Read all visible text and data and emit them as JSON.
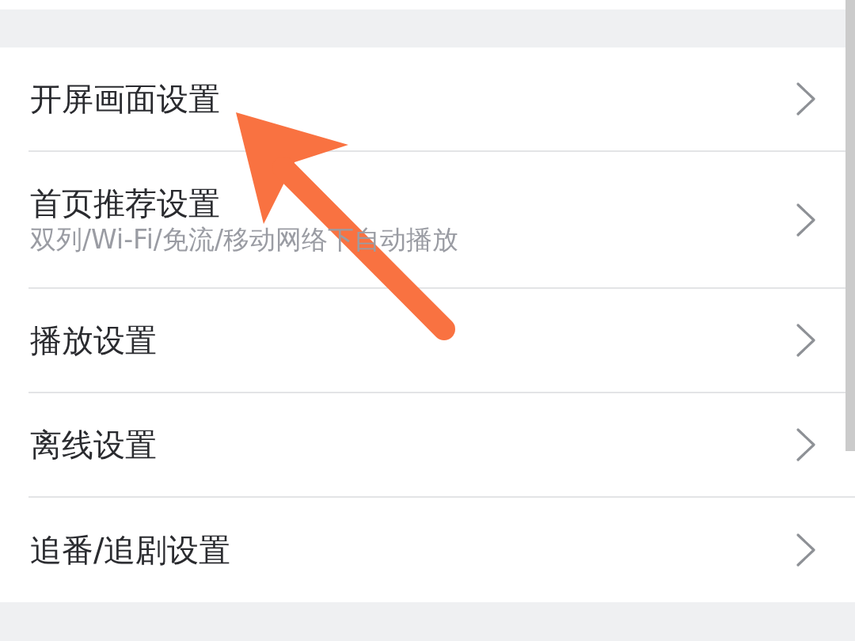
{
  "settings": [
    {
      "title": "开屏画面设置"
    },
    {
      "title": "首页推荐设置",
      "subtitle": "双列/Wi-Fi/免流/移动网络下自动播放"
    },
    {
      "title": "播放设置"
    },
    {
      "title": "离线设置"
    },
    {
      "title": "追番/追剧设置"
    }
  ]
}
